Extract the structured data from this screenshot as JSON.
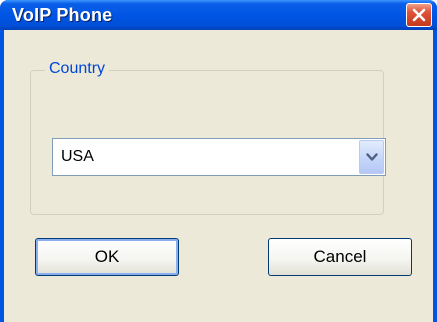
{
  "window": {
    "title": "VoIP Phone",
    "close_icon": "close-icon"
  },
  "country_group": {
    "legend": "Country",
    "selected_value": "USA",
    "dropdown_icon": "chevron-down-icon"
  },
  "buttons": {
    "ok_label": "OK",
    "cancel_label": "Cancel"
  },
  "colors": {
    "titlebar": "#0055e5",
    "client_bg": "#ece9d8",
    "legend_text": "#0046d5",
    "close_button": "#d24428"
  }
}
